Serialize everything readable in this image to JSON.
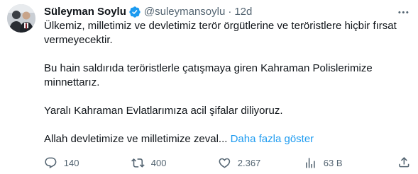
{
  "author": {
    "display_name": "Süleyman Soylu",
    "handle": "@suleymansoylu",
    "separator": "·",
    "time": "12d",
    "verified": true
  },
  "tweet": {
    "paragraphs": [
      "Ülkemiz, milletimiz ve devletimiz terör örgütlerine ve teröristlere hiçbir fırsat vermeyecektir.",
      "Bu hain saldırıda teröristlerle çatışmaya giren Kahraman Polislerimize minnettarız.",
      "Yaralı Kahraman Evlatlarımıza acil şifalar diliyoruz."
    ],
    "truncated_line": "Allah devletimize ve milletimize zeval...",
    "show_more": "Daha fazla göster"
  },
  "actions": {
    "reply_count": "140",
    "retweet_count": "400",
    "like_count": "2.367",
    "view_count": "63 B"
  },
  "icons": {
    "verified": "verified-badge-icon",
    "more": "more-options-icon",
    "reply": "reply-icon",
    "retweet": "retweet-icon",
    "like": "like-icon",
    "views": "views-icon",
    "share": "share-icon"
  },
  "colors": {
    "text": "#0f1419",
    "secondary": "#536471",
    "accent": "#1d9bf0"
  }
}
